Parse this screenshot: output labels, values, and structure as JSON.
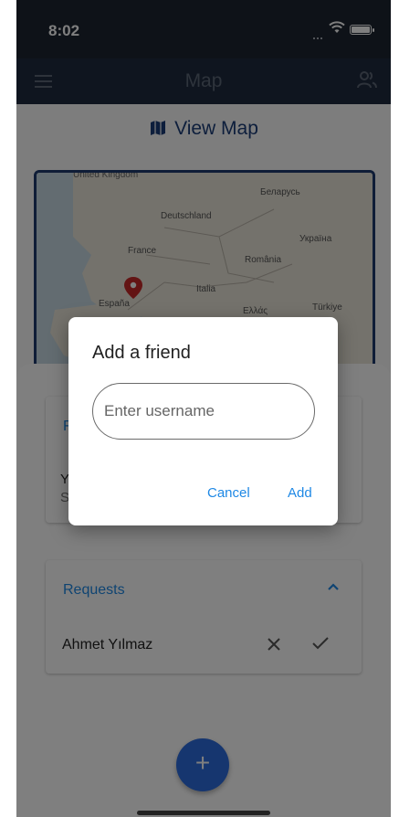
{
  "status_bar": {
    "time": "8:02"
  },
  "app_bar": {
    "title": "Map",
    "menu_icon": "menu-icon",
    "friends_icon": "friends-icon"
  },
  "map_section": {
    "heading": "View Map",
    "heading_icon": "map-icon",
    "labels": {
      "deutschland": "Deutschland",
      "belarus": "Беларусь",
      "france": "France",
      "ukraine": "Україна",
      "romania": "România",
      "italia": "Italia",
      "espana": "España",
      "greece": "Ελλάς",
      "turkiye": "Türkiye"
    }
  },
  "friends_card": {
    "title": "F",
    "line1": "Y",
    "line2": "S"
  },
  "requests_card": {
    "title": "Requests",
    "items": [
      {
        "name": "Ahmet Yılmaz"
      }
    ]
  },
  "dialog": {
    "title": "Add a friend",
    "input_placeholder": "Enter username",
    "input_value": "",
    "cancel_label": "Cancel",
    "add_label": "Add"
  },
  "fab": {
    "label": "+"
  },
  "colors": {
    "accent": "#1e88e5",
    "app_bar": "#1e2a3e",
    "fab": "#2d6cdf",
    "map_border": "#1e3a6e",
    "marker": "#c62828"
  }
}
